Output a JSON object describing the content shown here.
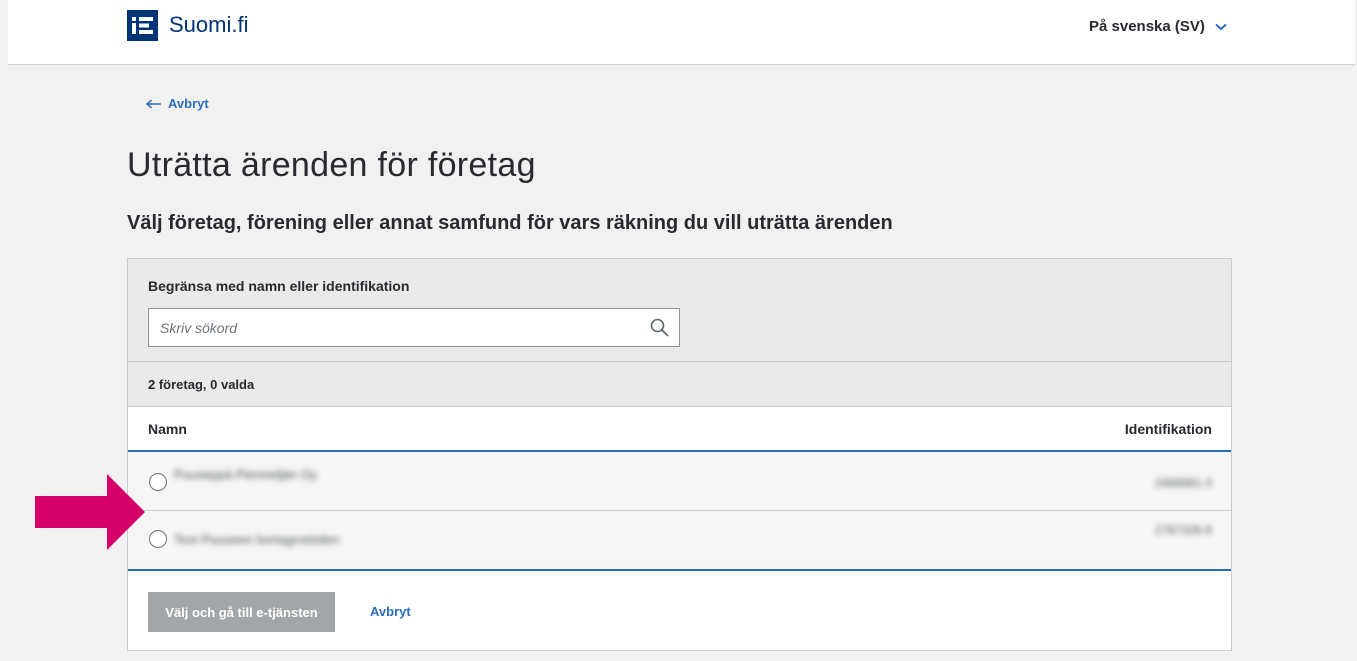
{
  "header": {
    "logo_text": "Suomi.fi",
    "language": "På svenska (SV)"
  },
  "back_link": "Avbryt",
  "page_title": "Uträtta ärenden för företag",
  "subtitle": "Välj företag, förening eller annat samfund för vars räkning du vill uträtta ärenden",
  "filter": {
    "label": "Begränsa med namn eller identifikation",
    "placeholder": "Skriv sökord",
    "value": ""
  },
  "count_text": "2 företag, 0 valda",
  "table": {
    "columns": [
      "Namn",
      "Identifikation"
    ],
    "rows": [
      {
        "name": "Puuseppä Pienneljän Oy",
        "id": "2468981-3"
      },
      {
        "name": "Toni Puuseen bortagnstöden",
        "id": "2787326-8"
      }
    ]
  },
  "actions": {
    "primary": "Välj och gå till e-tjänsten",
    "cancel": "Avbryt"
  },
  "colors": {
    "brand": "#003479",
    "link": "#2a6ebb",
    "annotation_arrow": "#d6006d",
    "disabled_button": "#a3a6a8"
  },
  "icons": {
    "logo": "suomi-fi-logo-icon",
    "language_toggle": "chevron-down-icon",
    "back": "arrow-left-icon",
    "search": "search-icon",
    "annotation": "arrow-right-icon"
  }
}
